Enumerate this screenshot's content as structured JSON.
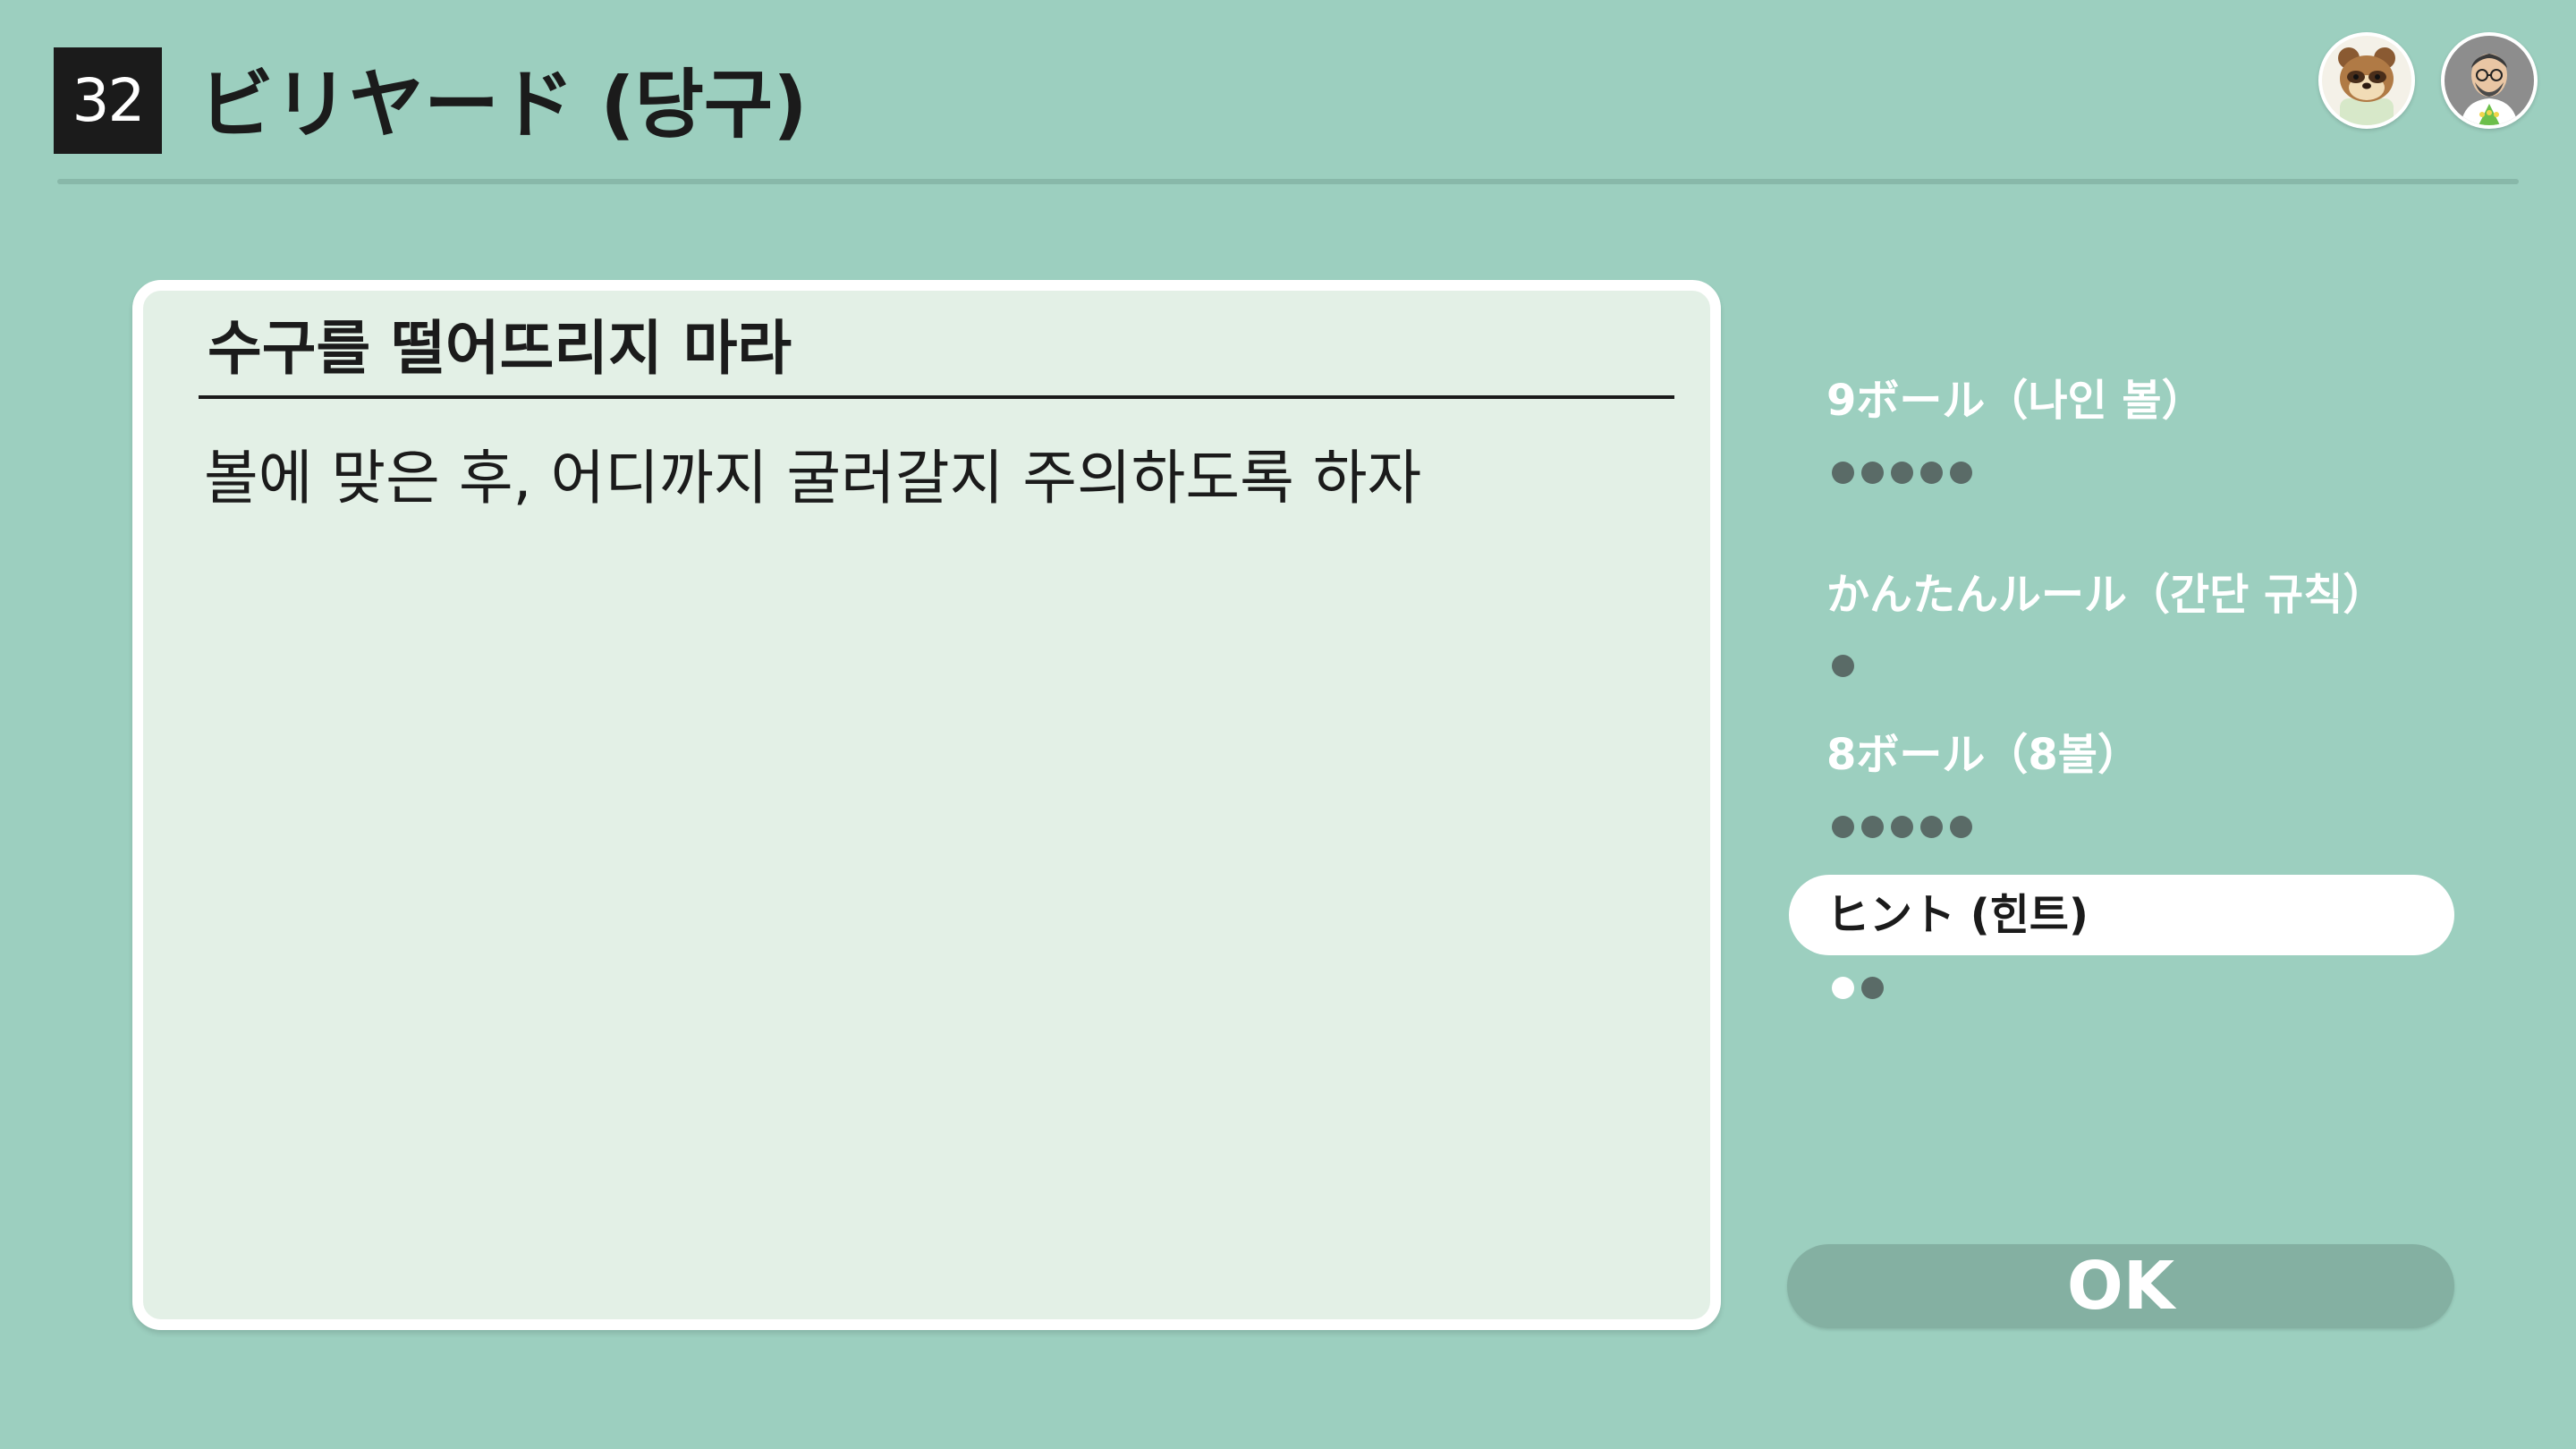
{
  "header": {
    "game_number": "32",
    "title": "ビリヤード (당구)"
  },
  "avatars": [
    {
      "name": "tom-nook-avatar-icon"
    },
    {
      "name": "mii-avatar-icon"
    }
  ],
  "panel": {
    "title": "수구를 떨어뜨리지 마라",
    "body": "볼에 맞은 후, 어디까지 굴러갈지 주의하도록 하자"
  },
  "menu": {
    "items": [
      {
        "label": "9ボール（나인 볼）",
        "difficulty": 5,
        "selected": false
      },
      {
        "label": "かんたんルール（간단 규칙）",
        "difficulty": 1,
        "selected": false
      },
      {
        "label": "8ボール（8볼）",
        "difficulty": 5,
        "selected": false
      },
      {
        "label": "ヒント (힌트)",
        "difficulty": 2,
        "selected": true
      }
    ]
  },
  "ok_button": {
    "label": "OK"
  },
  "colors": {
    "background": "#9ccfbf",
    "panel": "#e3f0e6",
    "ok_button": "#84b0a2",
    "dot": "#5a6b67"
  }
}
